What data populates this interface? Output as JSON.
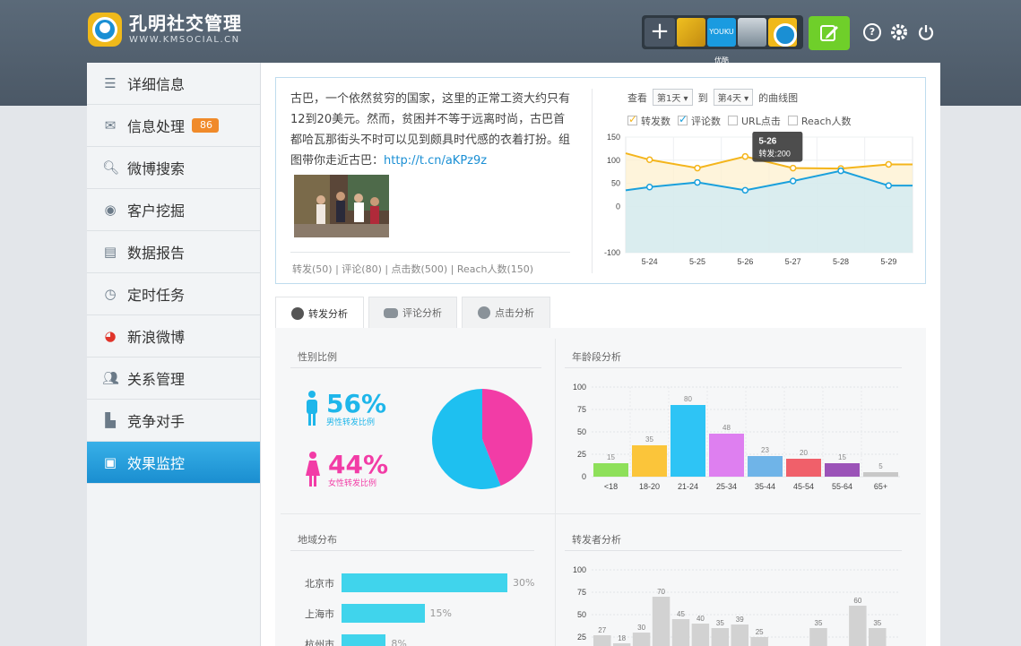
{
  "app": {
    "title": "孔明社交管理",
    "subtitle": "WWW.KMSOCIAL.CN",
    "youku_label": "YOUKU 优酷"
  },
  "header": {
    "help_icon": "?",
    "settings_icon": "gear-icon",
    "power_icon": "power-icon",
    "compose_icon": "edit-icon",
    "add_icon": "+"
  },
  "sidebar": {
    "items": [
      {
        "label": "详细信息",
        "icon": "list-icon"
      },
      {
        "label": "信息处理",
        "icon": "mail-icon",
        "badge": "86"
      },
      {
        "label": "微博搜索",
        "icon": "search-icon"
      },
      {
        "label": "客户挖掘",
        "icon": "target-icon"
      },
      {
        "label": "数据报告",
        "icon": "report-icon"
      },
      {
        "label": "定时任务",
        "icon": "clock-icon"
      },
      {
        "label": "新浪微博",
        "icon": "weibo-icon"
      },
      {
        "label": "关系管理",
        "icon": "users-icon"
      },
      {
        "label": "竞争对手",
        "icon": "competitor-icon"
      },
      {
        "label": "效果监控",
        "icon": "monitor-icon",
        "active": true
      }
    ]
  },
  "post": {
    "text": "古巴，一个依然贫穷的国家，这里的正常工资大约只有12到20美元。然而，贫困并不等于远离时尚，古巴首都哈瓦那街头不时可以见到颇具时代感的衣着打扮。组图带你走近古巴：",
    "link": "http://t.cn/aKPz9z",
    "stats": "转发(50) | 评论(80) | 点击数(500) | Reach人数(150)"
  },
  "chart_controls": {
    "view_label": "查看",
    "from_value": "第1天",
    "to_label": "到",
    "to_value": "第4天",
    "suffix": "的曲线图",
    "legend": [
      {
        "label": "转发数",
        "checked": true,
        "color": "#f4b51c"
      },
      {
        "label": "评论数",
        "checked": true,
        "color": "#1aa0dc"
      },
      {
        "label": "URL点击",
        "checked": false
      },
      {
        "label": "Reach人数",
        "checked": false
      }
    ],
    "tooltip": {
      "title": "5-26",
      "text": "转发:200"
    }
  },
  "tabs": [
    {
      "label": "转发分析",
      "icon": "pie-icon",
      "active": true
    },
    {
      "label": "评论分析",
      "icon": "comment-icon"
    },
    {
      "label": "点击分析",
      "icon": "click-icon"
    }
  ],
  "sections": {
    "gender": {
      "title": "性别比例",
      "male_pct": "56%",
      "male_label": "男性转发比例",
      "female_pct": "44%",
      "female_label": "女性转发比例"
    },
    "age": {
      "title": "年龄段分析"
    },
    "region": {
      "title": "地域分布"
    },
    "forwarders": {
      "title": "转发者分析"
    }
  },
  "chart_data": [
    {
      "type": "line",
      "categories": [
        "5-24",
        "5-25",
        "5-26",
        "5-27",
        "5-28",
        "5-29"
      ],
      "ylim": [
        -100,
        150
      ],
      "yticks": [
        150,
        100,
        50,
        0,
        -100
      ],
      "series": [
        {
          "name": "转发数",
          "color": "#f4b51c",
          "x": [
            0,
            0.5,
            1.5,
            2.5,
            3.5,
            4.5,
            5.5
          ],
          "values": [
            115,
            101,
            83,
            108,
            83,
            82,
            91
          ]
        },
        {
          "name": "评论数",
          "color": "#1aa0dc",
          "x": [
            0,
            0.5,
            1.5,
            2.5,
            3.5,
            4.5,
            5.5
          ],
          "values": [
            35,
            42,
            52,
            35,
            55,
            77,
            45
          ]
        }
      ]
    },
    {
      "type": "pie",
      "labels": [
        "男性转发比例",
        "女性转发比例"
      ],
      "values": [
        56,
        44
      ],
      "colors": [
        "#1ec0f0",
        "#f23ca6"
      ]
    },
    {
      "type": "bar",
      "categories": [
        "<18",
        "18-20",
        "21-24",
        "25-34",
        "35-44",
        "45-54",
        "55-64",
        "65+"
      ],
      "values": [
        15,
        35,
        80,
        48,
        23,
        20,
        15,
        5
      ],
      "colors": [
        "#8ee05a",
        "#fbc53a",
        "#2ec4f5",
        "#de7ff0",
        "#6fb4e8",
        "#f0606a",
        "#9b53b8",
        "#c8c8c8"
      ],
      "ylim": [
        0,
        100
      ],
      "yticks": [
        0,
        25,
        50,
        75,
        100
      ]
    },
    {
      "type": "bar",
      "categories": [
        "北京市",
        "上海市",
        "杭州市"
      ],
      "values": [
        30,
        15,
        8
      ],
      "value_labels": [
        "30%",
        "15%",
        "8%"
      ],
      "orientation": "horizontal"
    },
    {
      "type": "bar",
      "values": [
        27,
        18,
        30,
        70,
        45,
        40,
        35,
        39,
        25,
        35,
        60,
        35
      ],
      "ylim": [
        0,
        100
      ],
      "yticks": [
        25,
        50,
        75,
        100
      ]
    }
  ]
}
